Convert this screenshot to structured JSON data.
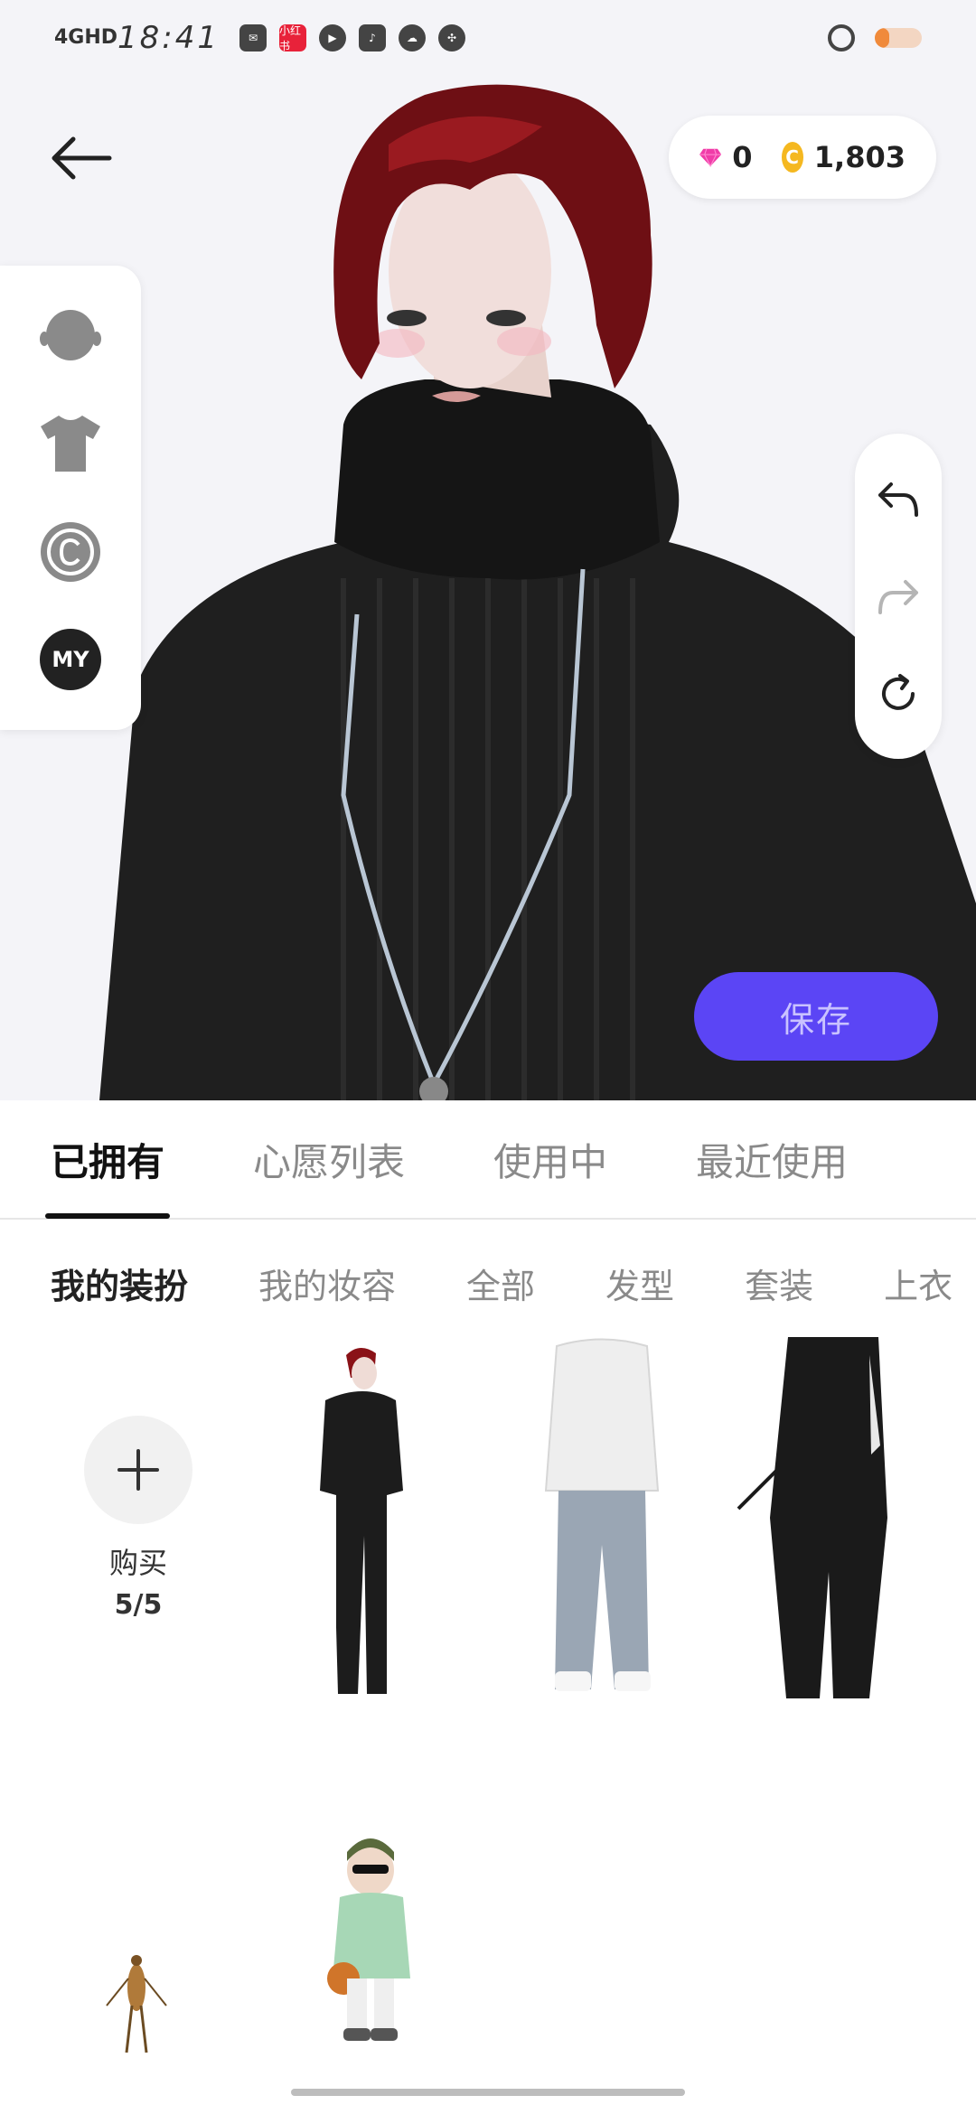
{
  "status_bar": {
    "network": "4GHD",
    "time": "18:41",
    "apps": [
      "mail-icon",
      "xiaohongshu-icon",
      "play-icon",
      "tiktok-icon",
      "cloud-icon",
      "fan-icon"
    ],
    "app_labels": [
      "",
      "小红书",
      "",
      "",
      "",
      ""
    ],
    "battery_level": 0.3
  },
  "currency": {
    "gems": "0",
    "coins": "1,803",
    "coin_symbol": "C"
  },
  "tools": {
    "my_label": "MY"
  },
  "save_label": "保存",
  "main_tabs": [
    "已拥有",
    "心愿列表",
    "使用中",
    "最近使用"
  ],
  "main_tab_active": 0,
  "sub_tabs": [
    "我的装扮",
    "我的妆容",
    "全部",
    "发型",
    "套装",
    "上衣"
  ],
  "sub_tab_active": 0,
  "buy_tile": {
    "label": "购买",
    "count": "5/5"
  },
  "outfits": [
    "outfit-black-white-jacket",
    "outfit-white-hoodie-jeans",
    "outfit-black-coat-cane",
    "outfit-insect",
    "outfit-green-hoodie-kid"
  ],
  "colors": {
    "accent": "#5b45f5",
    "gem": "#f03ca8",
    "coin": "#f5b820"
  }
}
